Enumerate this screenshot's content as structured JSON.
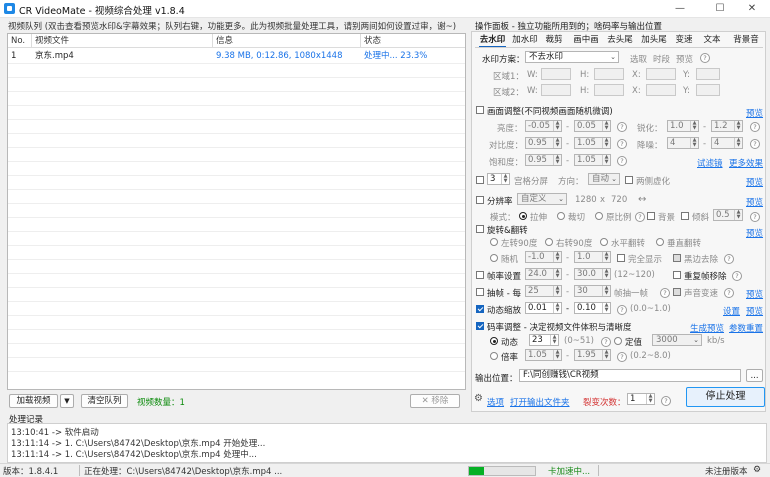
{
  "app": {
    "title": "CR VideoMate - 视频综合处理 v1.8.4"
  },
  "window_buttons": {
    "min": "—",
    "max": "☐",
    "close": "✕"
  },
  "queue": {
    "hint": "视频队列 (双击查看预览水印&字幕效果；队列右键，功能更多。此为视频批量处理工具，请别两间如何设置过审，谢~)",
    "columns": [
      "No.",
      "视频文件",
      "信息",
      "状态"
    ],
    "rows": [
      {
        "no": "1",
        "file": "京东.mp4",
        "info": "9.38 MB, 0:12.86, 1080x1448",
        "status": "处理中... 23.3%"
      }
    ],
    "add_label": "加载视频",
    "add_arrow": "▼",
    "clear_label": "清空队列",
    "count_label": "视频数量：1",
    "remove_label": "✕ 移除"
  },
  "log": {
    "title": "处理记录",
    "lines": [
      "13:10:41 -> 软件启动",
      "13:11:14 -> 1. C:\\Users\\84742\\Desktop\\京东.mp4 开始处理...",
      "13:11:14 -> 1. C:\\Users\\84742\\Desktop\\京东.mp4 处理中..."
    ]
  },
  "status": {
    "version": "版本：1.8.4.1",
    "processing": "正在处理：C:\\Users\\84742\\Desktop\\京东.mp4 ...",
    "progress": 0.23,
    "gpu": "卡加速中...",
    "unregistered": "未注册版本",
    "settings_icon": "gear-icon"
  },
  "panel": {
    "title": "操作面板 - 独立功能所用到的；啥码率与输出位置",
    "tabs": [
      "去水印",
      "加水印",
      "裁剪",
      "画中画",
      "去头尾",
      "加头尾",
      "变速",
      "文本",
      "背景音"
    ],
    "watermark": {
      "scheme_label": "水印方案：",
      "scheme_value": "不去水印",
      "options": [
        "选取",
        "时段",
        "预览"
      ],
      "region1": "区域1：",
      "region2": "区域2：",
      "w": "W:",
      "h": "H:",
      "x": "X:",
      "y": "Y:",
      "v0": "0"
    },
    "picture": {
      "title": "画面调整(不同视频画面随机微调)",
      "preset": "预览",
      "brightness": "亮度：",
      "contrast": "对比度：",
      "saturation": "饱和度：",
      "sharpen": "锐化：",
      "denoise": "降噪：",
      "b_min": "-0.05",
      "b_max": "0.05",
      "c_min": "0.95",
      "c_max": "1.05",
      "s_min": "0.95",
      "s_max": "1.05",
      "sh_min": "1.0",
      "sh_max": "1.2",
      "dn_min": "4",
      "dn_max": "4",
      "filter_link": "试滤镜",
      "more_link": "更多效果",
      "dash": "-"
    },
    "grid": {
      "value": "3",
      "label": "宫格分屏",
      "dir_label": "方向：",
      "dir_value": "自动",
      "blur_label": "两侧虚化",
      "preview": "预览"
    },
    "resolution": {
      "label": "分辨率",
      "value": "自定义",
      "w": "1280",
      "x": "x",
      "h": "720",
      "swap": "↔",
      "preview": "预览",
      "mode_label": "模式：",
      "modes": [
        "拉伸",
        "裁切",
        "原比例"
      ],
      "bg_label": "背景",
      "tilt_label": "倾斜",
      "tilt_value": "0.5"
    },
    "rotate": {
      "label": "旋转&翻转",
      "preview": "预览",
      "opts1": [
        "左转90度",
        "右转90度",
        "水平翻转",
        "垂直翻转"
      ],
      "random": "随机",
      "r_min": "-1.0",
      "r_max": "1.0",
      "full": "完全显示",
      "black": "黑边去除"
    },
    "fps": {
      "label": "帧率设置",
      "min": "24.0",
      "max": "30.0",
      "range": "(12~120)",
      "dedup": "重复帧移除"
    },
    "drop": {
      "label": "抽帧 - 每",
      "min": "25",
      "max": "30",
      "suffix": "帧抽一帧",
      "sound": "声音变速",
      "preview": "预览"
    },
    "zoom": {
      "label": "动态缩放",
      "min": "0.01",
      "max": "0.10",
      "range": "(0.0~1.0)",
      "settings": "设置",
      "preview": "预览"
    },
    "bitrate": {
      "label": "码率调整 - 决定视频文件体积与清晰度",
      "gen": "生成预览",
      "ref": "参数重置",
      "dynamic": "动态",
      "dyn_val": "23",
      "dyn_range": "(0~51)",
      "fixed": "定值",
      "fixed_val": "3000",
      "unit": "kb/s",
      "ratio": "倍率",
      "ra_min": "1.05",
      "ra_max": "1.95",
      "ra_range": "(0.2~8.0)"
    },
    "output": {
      "label": "输出位置：",
      "path": "F:\\同创赚钱\\CR视频",
      "browse": "..."
    },
    "bottom": {
      "options": "选项",
      "open_folder": "打开输出文件夹",
      "times_label": "裂变次数：",
      "times_value": "1",
      "stop": "停止处理"
    }
  }
}
